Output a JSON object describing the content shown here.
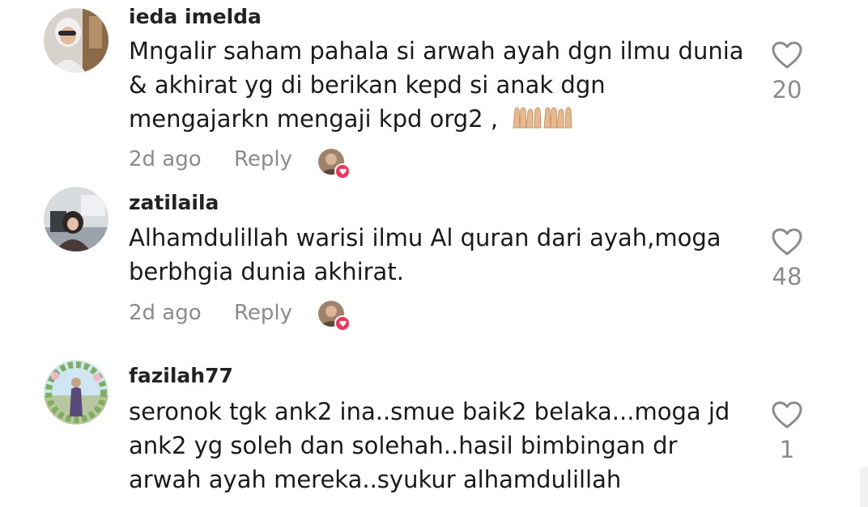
{
  "comments": [
    {
      "username": "ieda imelda",
      "text": "Mngalir saham pahala si arwah ayah dgn ilmu dunia & akhirat yg di berikan kepd si anak dgn mengajarkn mengaji kpd org2 ,",
      "emoji": "praying-hands-emoji",
      "time": "2d ago",
      "reply_label": "Reply",
      "likes": "20"
    },
    {
      "username": "zatilaila",
      "text": "Alhamdulillah warisi ilmu Al quran dari ayah,moga berbhgia dunia akhirat.",
      "time": "2d ago",
      "reply_label": "Reply",
      "likes": "48"
    },
    {
      "username": "fazilah77",
      "text": "seronok tgk ank2 ina..smue baik2 belaka...moga jd ank2 yg soleh dan solehah..hasil bimbingan dr arwah ayah mereka..syukur alhamdulillah",
      "likes": "1"
    }
  ],
  "icons": {
    "like": "heart-outline-icon",
    "creator_liked": "creator-liked-heart-badge"
  },
  "colors": {
    "muted": "#8a8b91",
    "badge": "#fe2c55"
  }
}
